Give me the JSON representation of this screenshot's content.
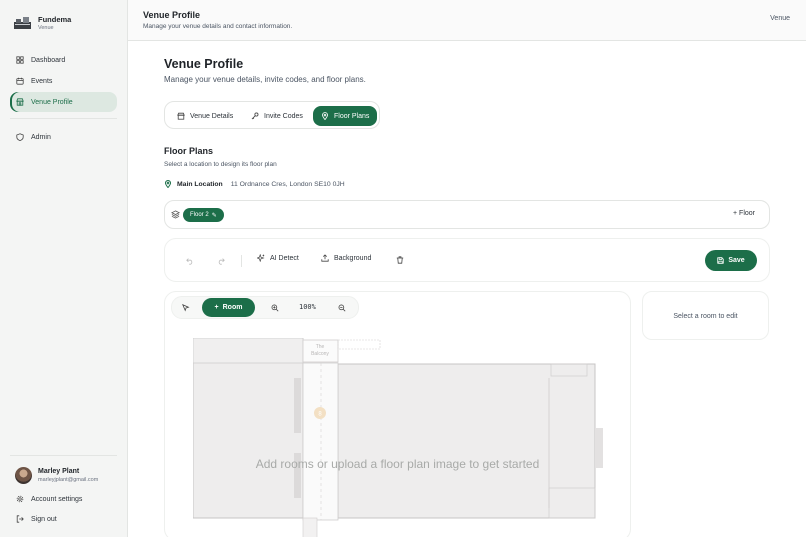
{
  "sidebar": {
    "brand_name": "Fundema",
    "brand_sub": "Venue",
    "items": [
      {
        "label": "Dashboard",
        "icon": "dashboard-icon"
      },
      {
        "label": "Events",
        "icon": "calendar-icon"
      },
      {
        "label": "Venue Profile",
        "icon": "store-icon",
        "active": true
      },
      {
        "label": "Admin",
        "icon": "shield-icon"
      }
    ],
    "user_name": "Marley Plant",
    "user_email": "marleyjplant@gmail.com",
    "account_settings": "Account settings",
    "sign_out": "Sign out"
  },
  "header": {
    "title": "Venue Profile",
    "subtitle": "Manage your venue details and contact information.",
    "right_label": "Venue"
  },
  "main": {
    "title": "Venue Profile",
    "subtitle": "Manage your venue details, invite codes, and floor plans.",
    "tabs": [
      {
        "label": "Venue Details",
        "icon": "building-icon"
      },
      {
        "label": "Invite Codes",
        "icon": "key-icon"
      },
      {
        "label": "Floor Plans",
        "icon": "map-pin-icon",
        "active": true
      }
    ],
    "section_title": "Floor Plans",
    "section_subtitle": "Select a location to design its floor plan",
    "location_name": "Main Location",
    "location_address": "11 Ordnance Cres, London SE10 0JH",
    "floor_chip": "Floor 2",
    "add_floor": "+ Floor"
  },
  "toolbar": {
    "ai_detect": "AI Detect",
    "background": "Background",
    "save": "Save"
  },
  "canvas": {
    "room_button": "Room",
    "zoom": "100%",
    "empty_message": "Add rooms or upload a floor plan image to get started",
    "balcony_label_1": "The",
    "balcony_label_2": "Balcony"
  },
  "side_panel": {
    "message": "Select a room to edit"
  },
  "colors": {
    "accent": "#1c6e49",
    "sidebar_bg": "#f4f5f4",
    "active_nav_bg": "#dde8e1"
  }
}
